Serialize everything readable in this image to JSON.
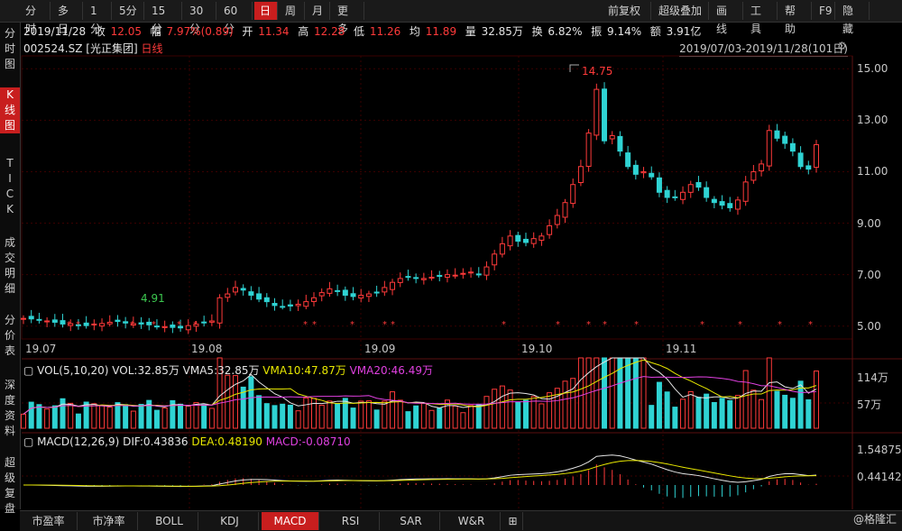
{
  "toolbar": {
    "items": [
      {
        "label": "分时",
        "active": false
      },
      {
        "label": "多日",
        "active": false
      },
      {
        "label": "1分",
        "active": false
      },
      {
        "label": "5分",
        "active": false
      },
      {
        "label": "15分",
        "active": false
      },
      {
        "label": "30分",
        "active": false
      },
      {
        "label": "60分",
        "active": false
      },
      {
        "label": "日",
        "active": true
      },
      {
        "label": "周",
        "active": false
      },
      {
        "label": "月",
        "active": false
      },
      {
        "label": "更多",
        "active": false
      }
    ],
    "right_items": [
      "前复权",
      "超级叠加",
      "画线",
      "工具",
      "帮助",
      "F9",
      "隐藏"
    ]
  },
  "sidebar": {
    "items": [
      {
        "label": "分时图",
        "active": false
      },
      {
        "label": "K线图",
        "active": true
      },
      {
        "label": "TICK",
        "active": false
      },
      {
        "label": "成交明细",
        "active": false
      },
      {
        "label": "分价表",
        "active": false
      },
      {
        "label": "深度资料",
        "active": false
      },
      {
        "label": "超级复盘",
        "active": false
      }
    ]
  },
  "quote": {
    "date": "2019/11/28",
    "close_label": "收",
    "close": "12.05",
    "change_label": "幅",
    "change": "7.97%(0.89)",
    "open_label": "开",
    "open": "11.34",
    "high_label": "高",
    "high": "12.28",
    "low_label": "低",
    "low": "11.26",
    "avg_label": "均",
    "avg": "11.89",
    "vol_label": "量",
    "vol": "32.85万",
    "turn_label": "换",
    "turn": "6.82%",
    "amp_label": "振",
    "amp": "9.14%",
    "amt_label": "额",
    "amt": "3.91亿"
  },
  "chart_header": {
    "code": "002524.SZ [光正集团]",
    "period": "日线",
    "range": "2019/07/03-2019/11/28(101日)"
  },
  "annotations": {
    "max": "14.75",
    "min": "4.91"
  },
  "price_axis": [
    "15.00",
    "13.00",
    "11.00",
    "9.00",
    "7.00",
    "5.00"
  ],
  "date_axis": [
    "19.07",
    "19.08",
    "19.09",
    "19.10",
    "19.11"
  ],
  "volume_panel": {
    "title": "VOL(5,10,20)",
    "vol": "VOL:32.85万",
    "vma5": "VMA5:32.85万",
    "vma10": "VMA10:47.87万",
    "vma20": "VMA20:46.49万",
    "axis": [
      "114万",
      "57万"
    ]
  },
  "macd_panel": {
    "title": "MACD(12,26,9)",
    "dif": "DIF:0.43836",
    "dea": "DEA:0.48190",
    "macd": "MACD:-0.08710",
    "axis": [
      "1.54875",
      "0.44142"
    ]
  },
  "bottom_tabs": [
    {
      "label": "市盈率",
      "active": false
    },
    {
      "label": "市净率",
      "active": false
    },
    {
      "label": "BOLL",
      "active": false
    },
    {
      "label": "KDJ",
      "active": false
    },
    {
      "label": "MACD",
      "active": true
    },
    {
      "label": "RSI",
      "active": false
    },
    {
      "label": "SAR",
      "active": false
    },
    {
      "label": "W&R",
      "active": false
    },
    {
      "label": "⊞",
      "active": false
    }
  ],
  "brand": "@格隆汇",
  "colors": {
    "up": "#ff3a3a",
    "down": "#2fd3d3",
    "active": "#c81e1e"
  },
  "chart_data": {
    "type": "candlestick",
    "ylim": [
      4.5,
      15.5
    ],
    "closes": [
      5.3,
      5.28,
      5.25,
      5.2,
      5.15,
      5.08,
      5.1,
      5.05,
      5.02,
      5.08,
      5.1,
      5.15,
      5.18,
      5.12,
      5.1,
      5.08,
      5.05,
      5.0,
      4.98,
      4.95,
      4.93,
      5.02,
      5.08,
      5.15,
      5.2,
      6.1,
      6.25,
      6.5,
      6.4,
      6.2,
      6.05,
      5.95,
      5.8,
      5.75,
      5.78,
      5.85,
      5.95,
      6.1,
      6.3,
      6.45,
      6.35,
      6.2,
      6.15,
      6.2,
      6.25,
      6.3,
      6.5,
      6.7,
      6.85,
      6.9,
      6.88,
      6.85,
      6.9,
      6.95,
      7.0,
      6.98,
      7.05,
      7.1,
      7.0,
      7.3,
      7.8,
      8.2,
      8.5,
      8.3,
      8.25,
      8.4,
      8.5,
      8.9,
      9.3,
      9.8,
      10.5,
      11.2,
      12.5,
      14.2,
      12.2,
      12.4,
      11.8,
      11.2,
      10.9,
      11.0,
      10.8,
      10.2,
      10.0,
      10.0,
      10.2,
      10.5,
      10.4,
      10.0,
      9.8,
      9.7,
      9.6,
      9.9,
      10.6,
      11.0,
      11.3,
      12.6,
      12.3,
      12.1,
      11.8,
      11.2,
      11.1,
      12.05
    ]
  }
}
